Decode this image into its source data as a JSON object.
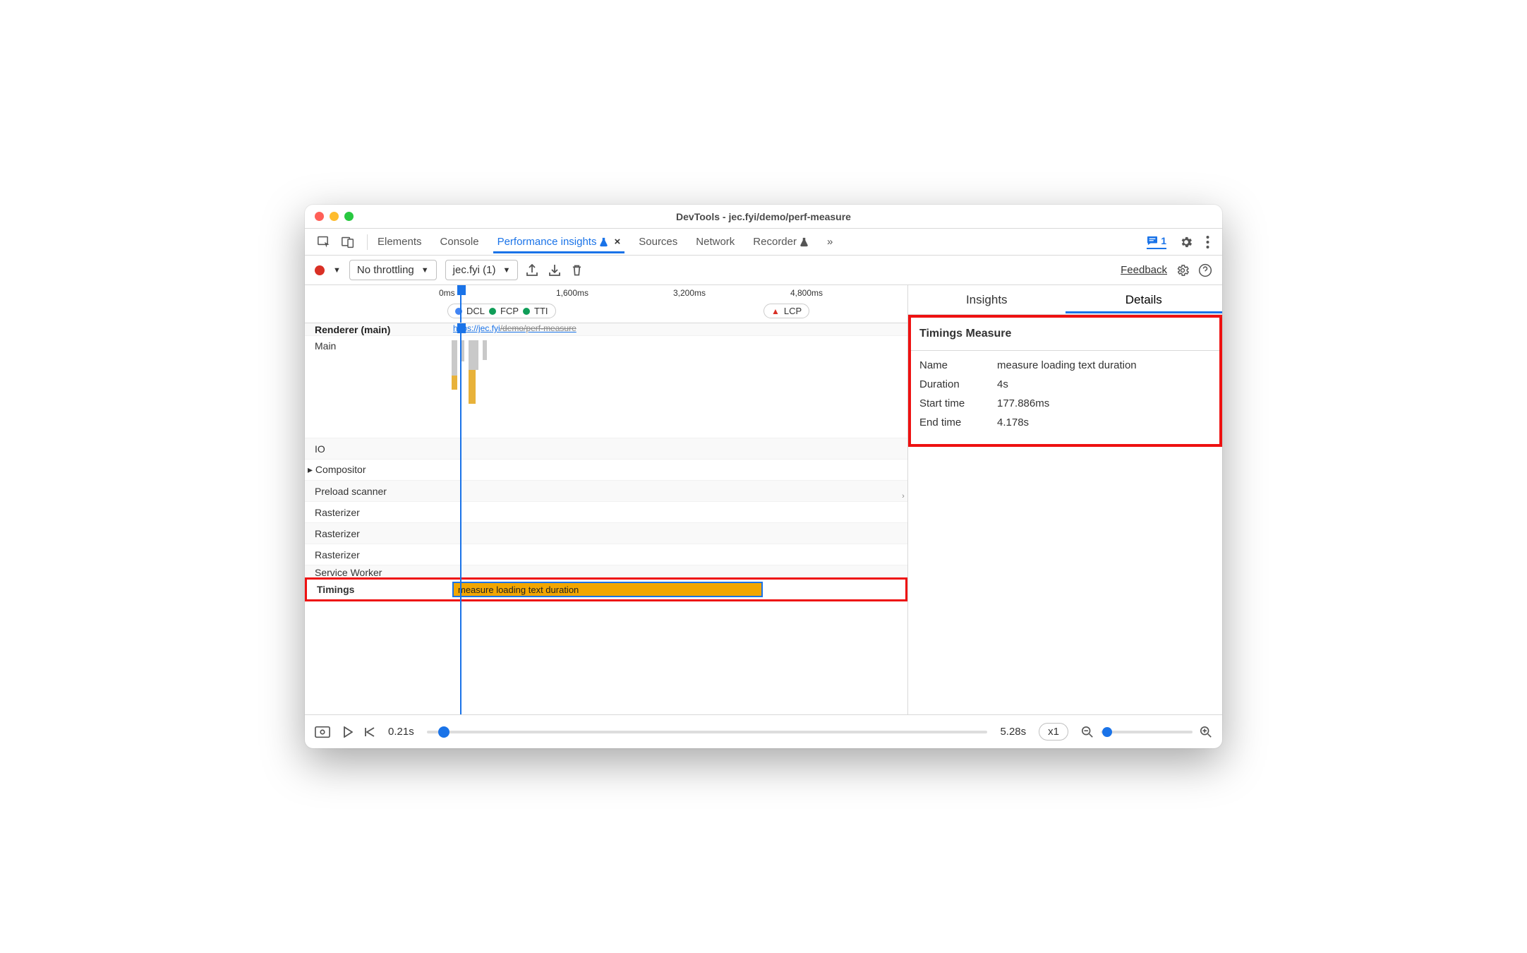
{
  "window": {
    "title": "DevTools - jec.fyi/demo/perf-measure"
  },
  "tabs": {
    "elements": "Elements",
    "console": "Console",
    "perf_insights": "Performance insights",
    "sources": "Sources",
    "network": "Network",
    "recorder": "Recorder",
    "more": "»",
    "close_x": "×",
    "issues_count": "1"
  },
  "toolbar": {
    "throttling": "No throttling",
    "session": "jec.fyi (1)",
    "feedback": "Feedback"
  },
  "ruler": {
    "ticks": [
      "0ms",
      "1,600ms",
      "3,200ms",
      "4,800ms"
    ],
    "badges": {
      "dcl": "DCL",
      "fcp": "FCP",
      "tti": "TTI",
      "lcp": "LCP"
    }
  },
  "tracks": {
    "url_prefix": "https://jec.fyi",
    "url_path": "/demo/perf-measure",
    "renderer": "Renderer (main)",
    "main": "Main",
    "io": "IO",
    "compositor": "Compositor",
    "preload": "Preload scanner",
    "rasterizer": "Rasterizer",
    "service_worker": "Service Worker",
    "timings": "Timings",
    "measure_label": "measure loading text duration"
  },
  "right": {
    "insights": "Insights",
    "details": "Details",
    "panel_title": "Timings Measure",
    "rows": {
      "name_k": "Name",
      "name_v": "measure loading text duration",
      "dur_k": "Duration",
      "dur_v": "4s",
      "start_k": "Start time",
      "start_v": "177.886ms",
      "end_k": "End time",
      "end_v": "4.178s"
    }
  },
  "footer": {
    "start": "0.21s",
    "end": "5.28s",
    "speed": "x1"
  }
}
